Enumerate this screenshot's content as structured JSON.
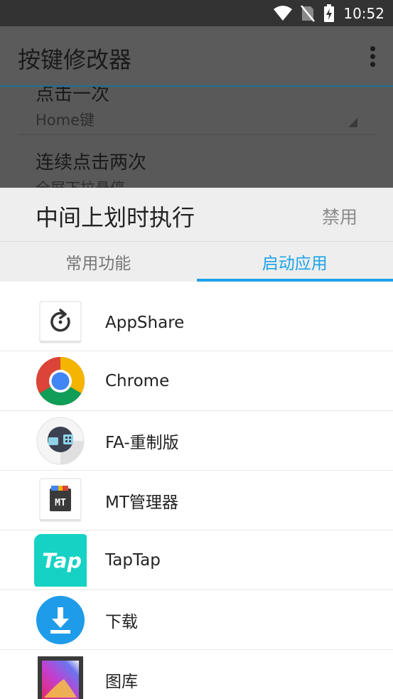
{
  "status_bar": {
    "time": "10:52"
  },
  "app_bar": {
    "title": "按键修改器"
  },
  "background_list": {
    "items": [
      {
        "title": "点击一次",
        "subtitle": "Home键"
      },
      {
        "title": "连续点击两次",
        "subtitle": "全屏下拉悬停"
      }
    ]
  },
  "dialog": {
    "title": "中间上划时执行",
    "disable_label": "禁用",
    "tabs": [
      {
        "label": "常用功能",
        "active": false
      },
      {
        "label": "启动应用",
        "active": true
      }
    ],
    "apps": [
      {
        "label": "AppShare",
        "icon": "appshare-icon"
      },
      {
        "label": "Chrome",
        "icon": "chrome-icon"
      },
      {
        "label": "FA-重制版",
        "icon": "fa-icon"
      },
      {
        "label": "MT管理器",
        "icon": "mt-manager-icon"
      },
      {
        "label": "TapTap",
        "icon": "taptap-icon"
      },
      {
        "label": "下载",
        "icon": "download-icon"
      },
      {
        "label": "图库",
        "icon": "gallery-icon"
      }
    ],
    "accent_color": "#1ba3e8"
  }
}
